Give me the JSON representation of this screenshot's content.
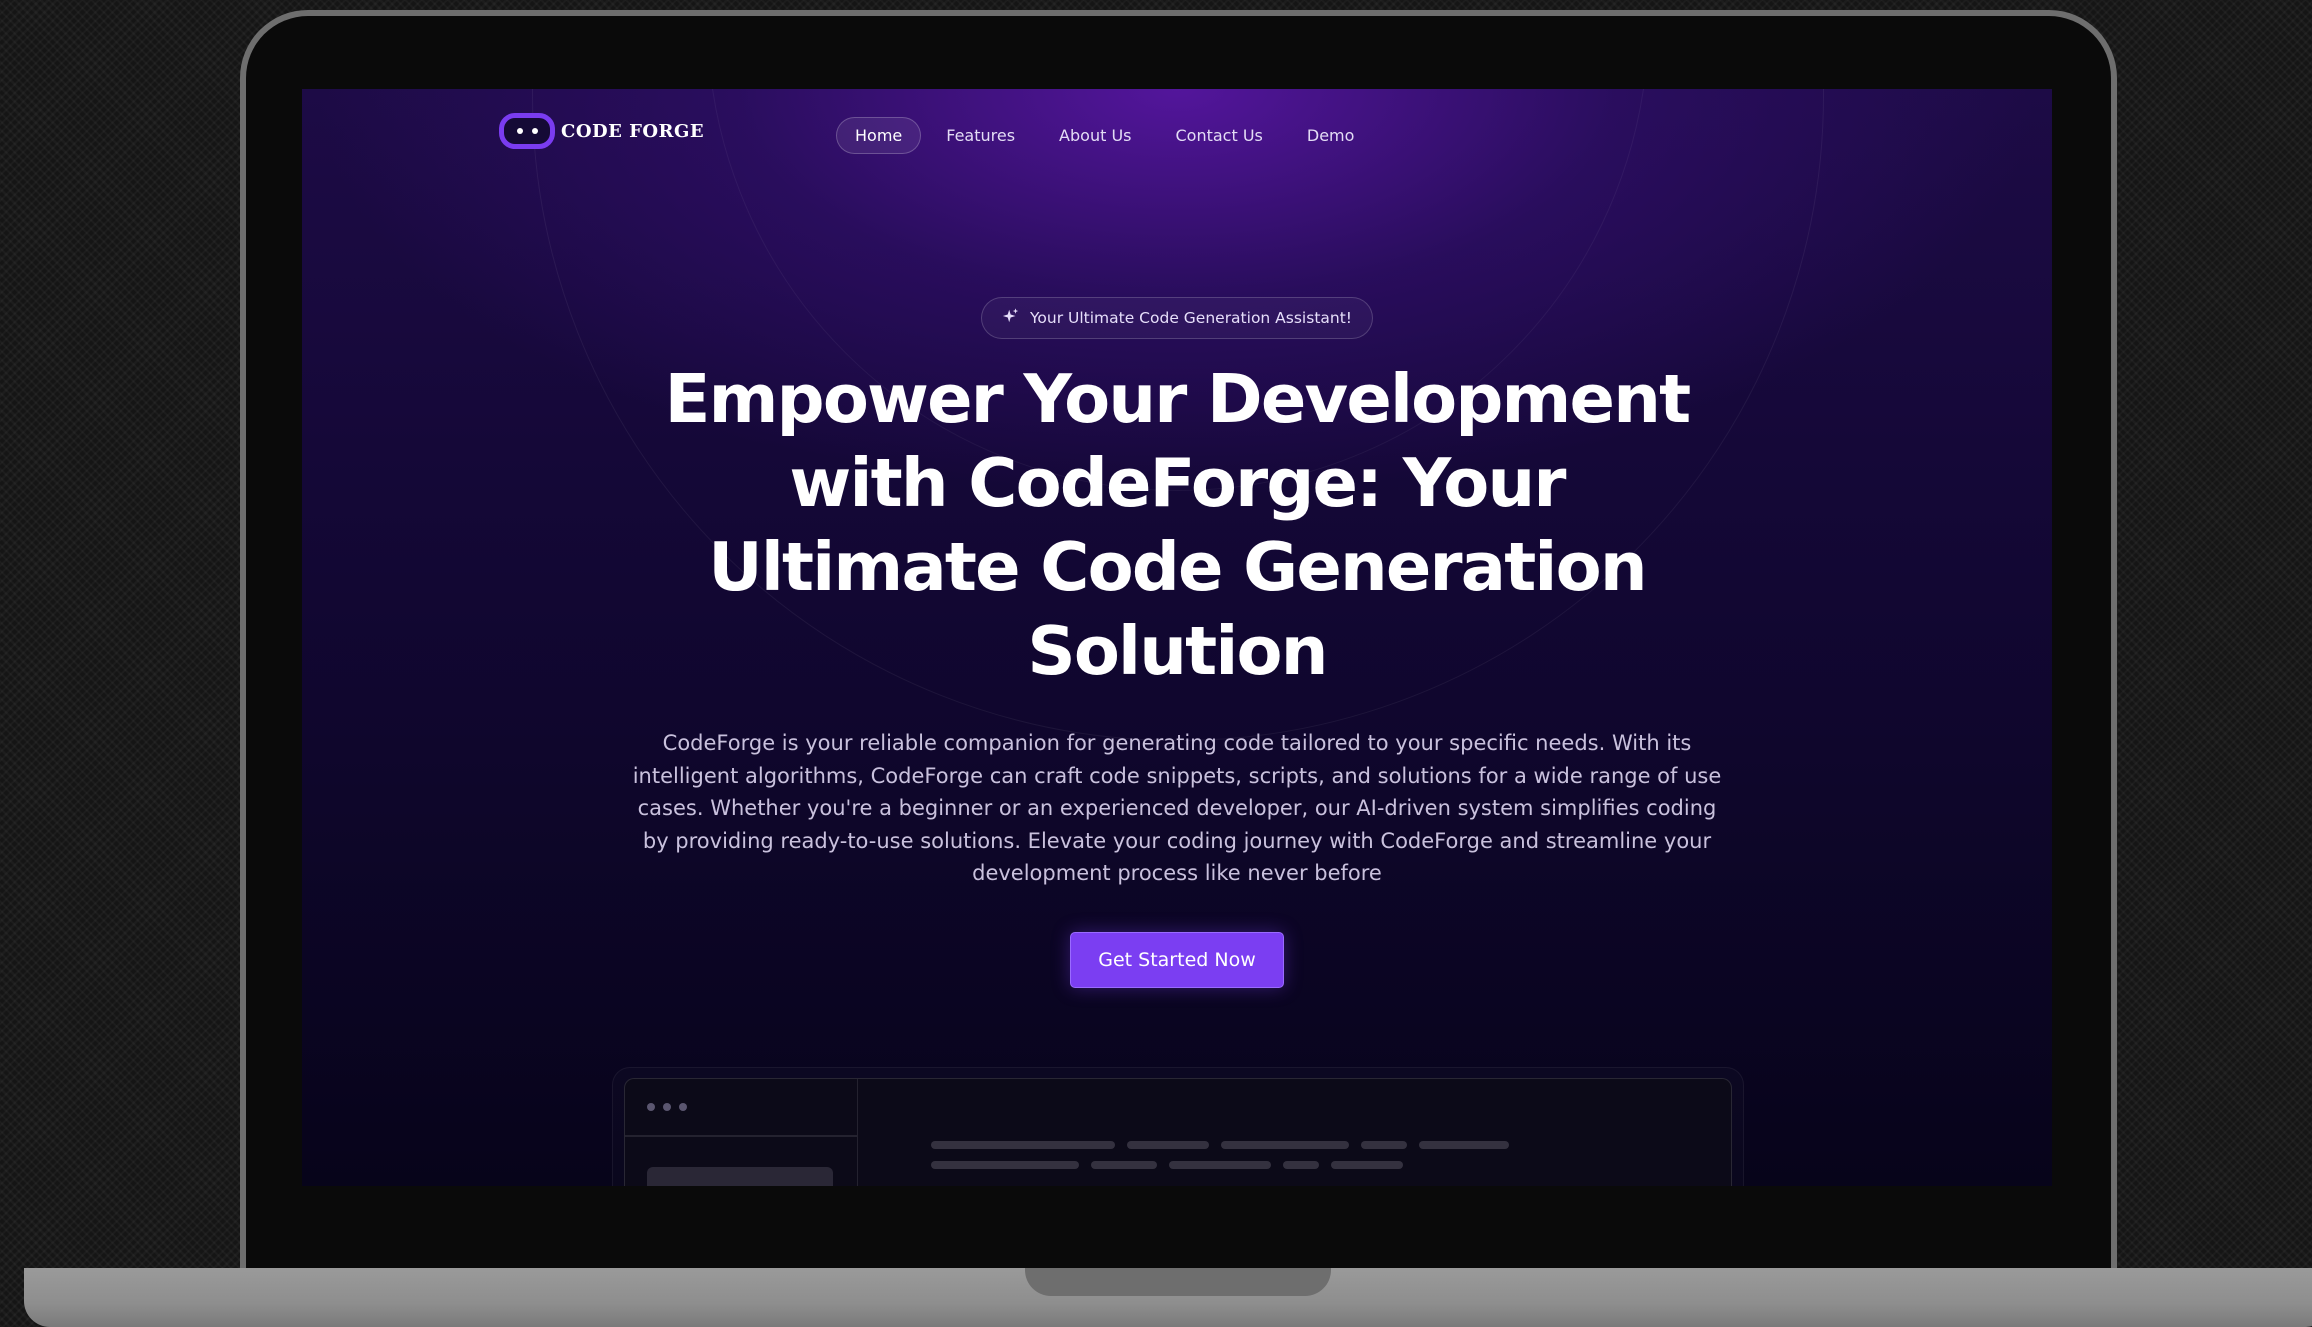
{
  "brand": {
    "name": "CODE FORGE"
  },
  "nav": {
    "items": [
      {
        "label": "Home",
        "active": true
      },
      {
        "label": "Features",
        "active": false
      },
      {
        "label": "About Us",
        "active": false
      },
      {
        "label": "Contact Us",
        "active": false
      },
      {
        "label": "Demo",
        "active": false
      }
    ]
  },
  "hero": {
    "badge": "Your Ultimate Code Generation Assistant!",
    "badge_icon": "sparkle-icon",
    "headline_lines": [
      "Empower Your Development",
      "with CodeForge: Your",
      "Ultimate Code Generation",
      "Solution"
    ],
    "description": "CodeForge is your reliable companion for generating code tailored to your specific needs. With its intelligent algorithms, CodeForge can craft code snippets, scripts, and solutions for a wide range of use cases. Whether you're a beginner or an experienced developer, our AI-driven system simplifies coding by providing ready-to-use solutions. Elevate your coding journey with CodeForge and streamline your development process like never before",
    "cta_label": "Get Started Now"
  },
  "colors": {
    "accent": "#7b3ef2",
    "background_top": "#1d0b46",
    "background_bottom": "#07041a",
    "text_primary": "#ffffff",
    "text_secondary": "#c9c1dd"
  }
}
